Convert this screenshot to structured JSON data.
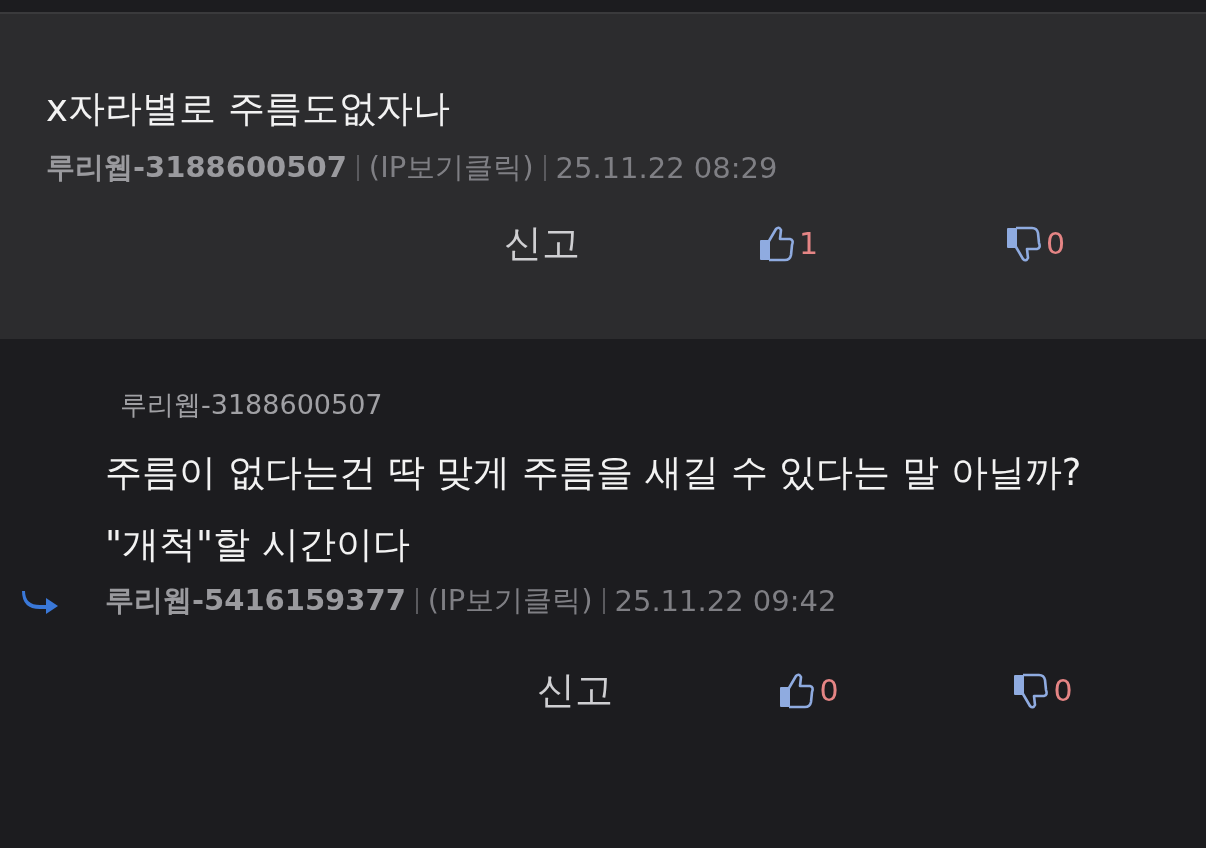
{
  "comments": [
    {
      "kind": "comment",
      "body": [
        "x자라별로 주름도없자나"
      ],
      "author": "루리웹-3188600507",
      "ip": "(IP보기클릭)",
      "time": "25.11.22 08:29",
      "report": "신고",
      "likes": "1",
      "dislikes": "0"
    },
    {
      "kind": "reply",
      "reply_to": "루리웹-3188600507",
      "body": [
        "주름이 없다는건 딱 맞게 주름을 새길 수 있다는 말 아닐까?",
        "\"개척\"할 시간이다"
      ],
      "author": "루리웹-5416159377",
      "ip": "(IP보기클릭)",
      "time": "25.11.22 09:42",
      "report": "신고",
      "likes": "0",
      "dislikes": "0"
    }
  ]
}
